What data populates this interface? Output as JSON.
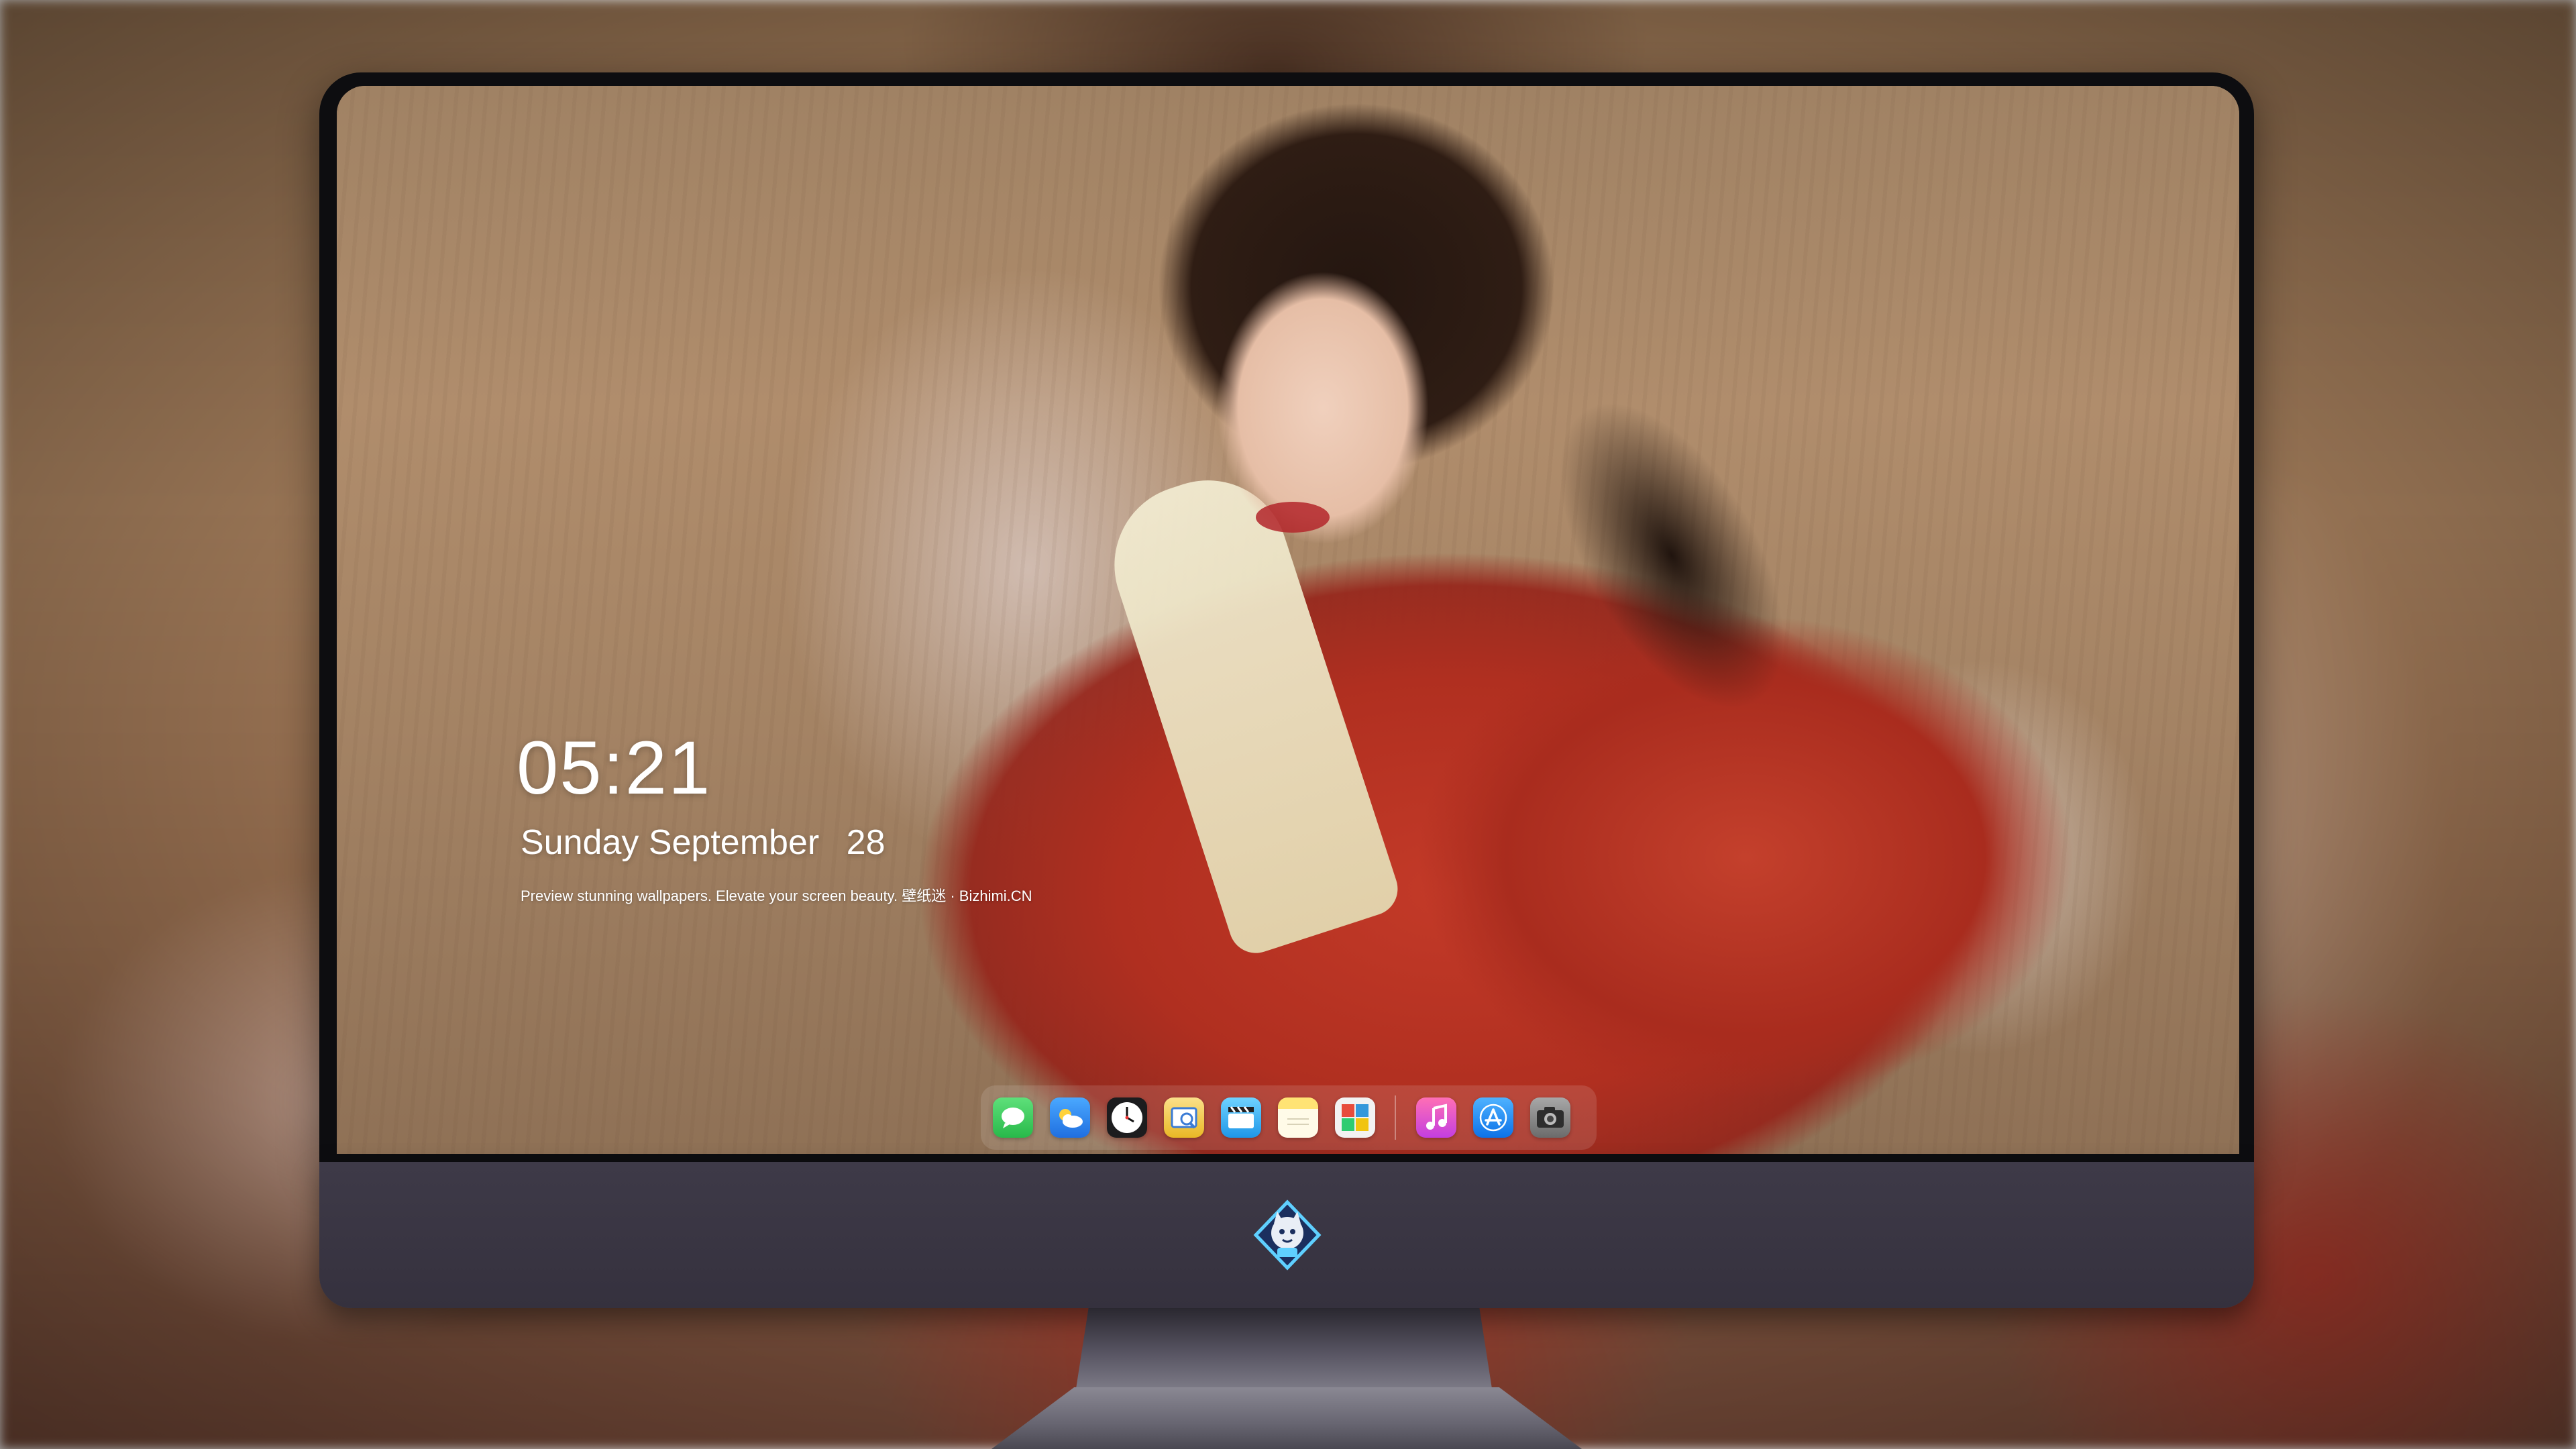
{
  "lock_screen": {
    "time": "05:21",
    "weekday": "Sunday",
    "month": "September",
    "day": "28",
    "tagline": "Preview stunning wallpapers. Elevate your screen beauty. 壁纸迷 · Bizhimi.CN"
  },
  "dock": {
    "apps": [
      {
        "name": "messages-icon",
        "color": "#34c759"
      },
      {
        "name": "weather-icon",
        "color": "#2f8cff"
      },
      {
        "name": "clock-icon",
        "color": "#ffffff"
      },
      {
        "name": "preview-icon",
        "color": "#f2c230"
      },
      {
        "name": "clips-icon",
        "color": "#2ea5f5"
      },
      {
        "name": "notes-icon",
        "color": "#fbd94c"
      },
      {
        "name": "photo-booth-icon",
        "color": "#e6e6e6"
      },
      {
        "name": "itunes-icon",
        "color": "#f04aa6"
      },
      {
        "name": "app-store-icon",
        "color": "#1a8cff"
      },
      {
        "name": "camera-icon",
        "color": "#8a8a8a"
      }
    ]
  },
  "colors": {
    "bezel": "#0d0d10",
    "chin": "#3e3a48",
    "robe_red": "#c33a28"
  }
}
